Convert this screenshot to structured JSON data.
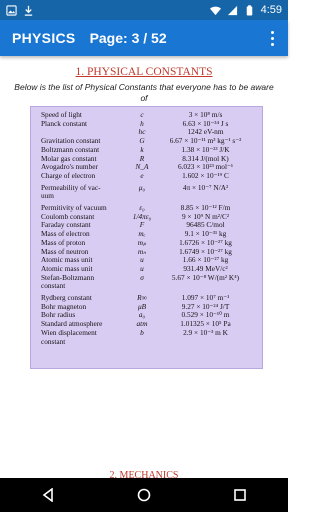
{
  "status_bar": {
    "time": "4:59"
  },
  "app_bar": {
    "title": "PHYSICS",
    "page": "Page: 3 / 52"
  },
  "section": {
    "title": "1. PHYSICAL CONSTANTS",
    "intro": "Below is the list of Physical Constants that everyone has to be aware of"
  },
  "constants": [
    {
      "name": "Speed of light",
      "symbol": "c",
      "value": "3 × 10⁸ m/s"
    },
    {
      "name": "Planck constant",
      "symbol": "h",
      "value": "6.63 × 10⁻³⁴ J s"
    },
    {
      "name": "",
      "symbol": "hc",
      "value": "1242 eV-nm"
    },
    {
      "name": "Gravitation constant",
      "symbol": "G",
      "value": "6.67 × 10⁻¹¹ m³ kg⁻¹ s⁻²"
    },
    {
      "name": "Boltzmann constant",
      "symbol": "k",
      "value": "1.38 × 10⁻²³ J/K"
    },
    {
      "name": "Molar gas constant",
      "symbol": "R",
      "value": "8.314 J/(mol K)"
    },
    {
      "name": "Avogadro's number",
      "symbol": "N_A",
      "value": "6.023 × 10²³ mol⁻¹"
    },
    {
      "name": "Charge of electron",
      "symbol": "e",
      "value": "1.602 × 10⁻¹⁹ C"
    },
    {
      "name": "Permeability of vac-",
      "symbol": "μ₀",
      "value": "4π × 10⁻⁷ N/A²"
    },
    {
      "name": "uum",
      "symbol": "",
      "value": ""
    },
    {
      "name": "Permitivity of vacuum",
      "symbol": "ε₀",
      "value": "8.85 × 10⁻¹² F/m"
    },
    {
      "name": "Coulomb constant",
      "symbol": "1/4πε₀",
      "value": "9 × 10⁹ N m²/C²"
    },
    {
      "name": "Faraday constant",
      "symbol": "F",
      "value": "96485 C/mol"
    },
    {
      "name": "Mass of electron",
      "symbol": "mₑ",
      "value": "9.1 × 10⁻³¹ kg"
    },
    {
      "name": "Mass of proton",
      "symbol": "mₚ",
      "value": "1.6726 × 10⁻²⁷ kg"
    },
    {
      "name": "Mass of neutron",
      "symbol": "mₙ",
      "value": "1.6749 × 10⁻²⁷ kg"
    },
    {
      "name": "Atomic mass unit",
      "symbol": "u",
      "value": "1.66 × 10⁻²⁷ kg"
    },
    {
      "name": "Atomic mass unit",
      "symbol": "u",
      "value": "931.49 MeV/c²"
    },
    {
      "name": "Stefan-Boltzmann",
      "symbol": "σ",
      "value": "5.67 × 10⁻⁸ W/(m² K⁴)"
    },
    {
      "name": "constant",
      "symbol": "",
      "value": ""
    },
    {
      "name": "Rydberg constant",
      "symbol": "R∞",
      "value": "1.097 × 10⁷ m⁻¹"
    },
    {
      "name": "Bohr magneton",
      "symbol": "μB",
      "value": "9.27 × 10⁻²⁴ J/T"
    },
    {
      "name": "Bohr radius",
      "symbol": "a₀",
      "value": "0.529 × 10⁻¹⁰ m"
    },
    {
      "name": "Standard atmosphere",
      "symbol": "atm",
      "value": "1.01325 × 10⁵ Pa"
    },
    {
      "name": "Wien displacement",
      "symbol": "b",
      "value": "2.9 × 10⁻³ m K"
    },
    {
      "name": "constant",
      "symbol": "",
      "value": ""
    }
  ],
  "next_section": {
    "title": "2. MECHANICS"
  }
}
